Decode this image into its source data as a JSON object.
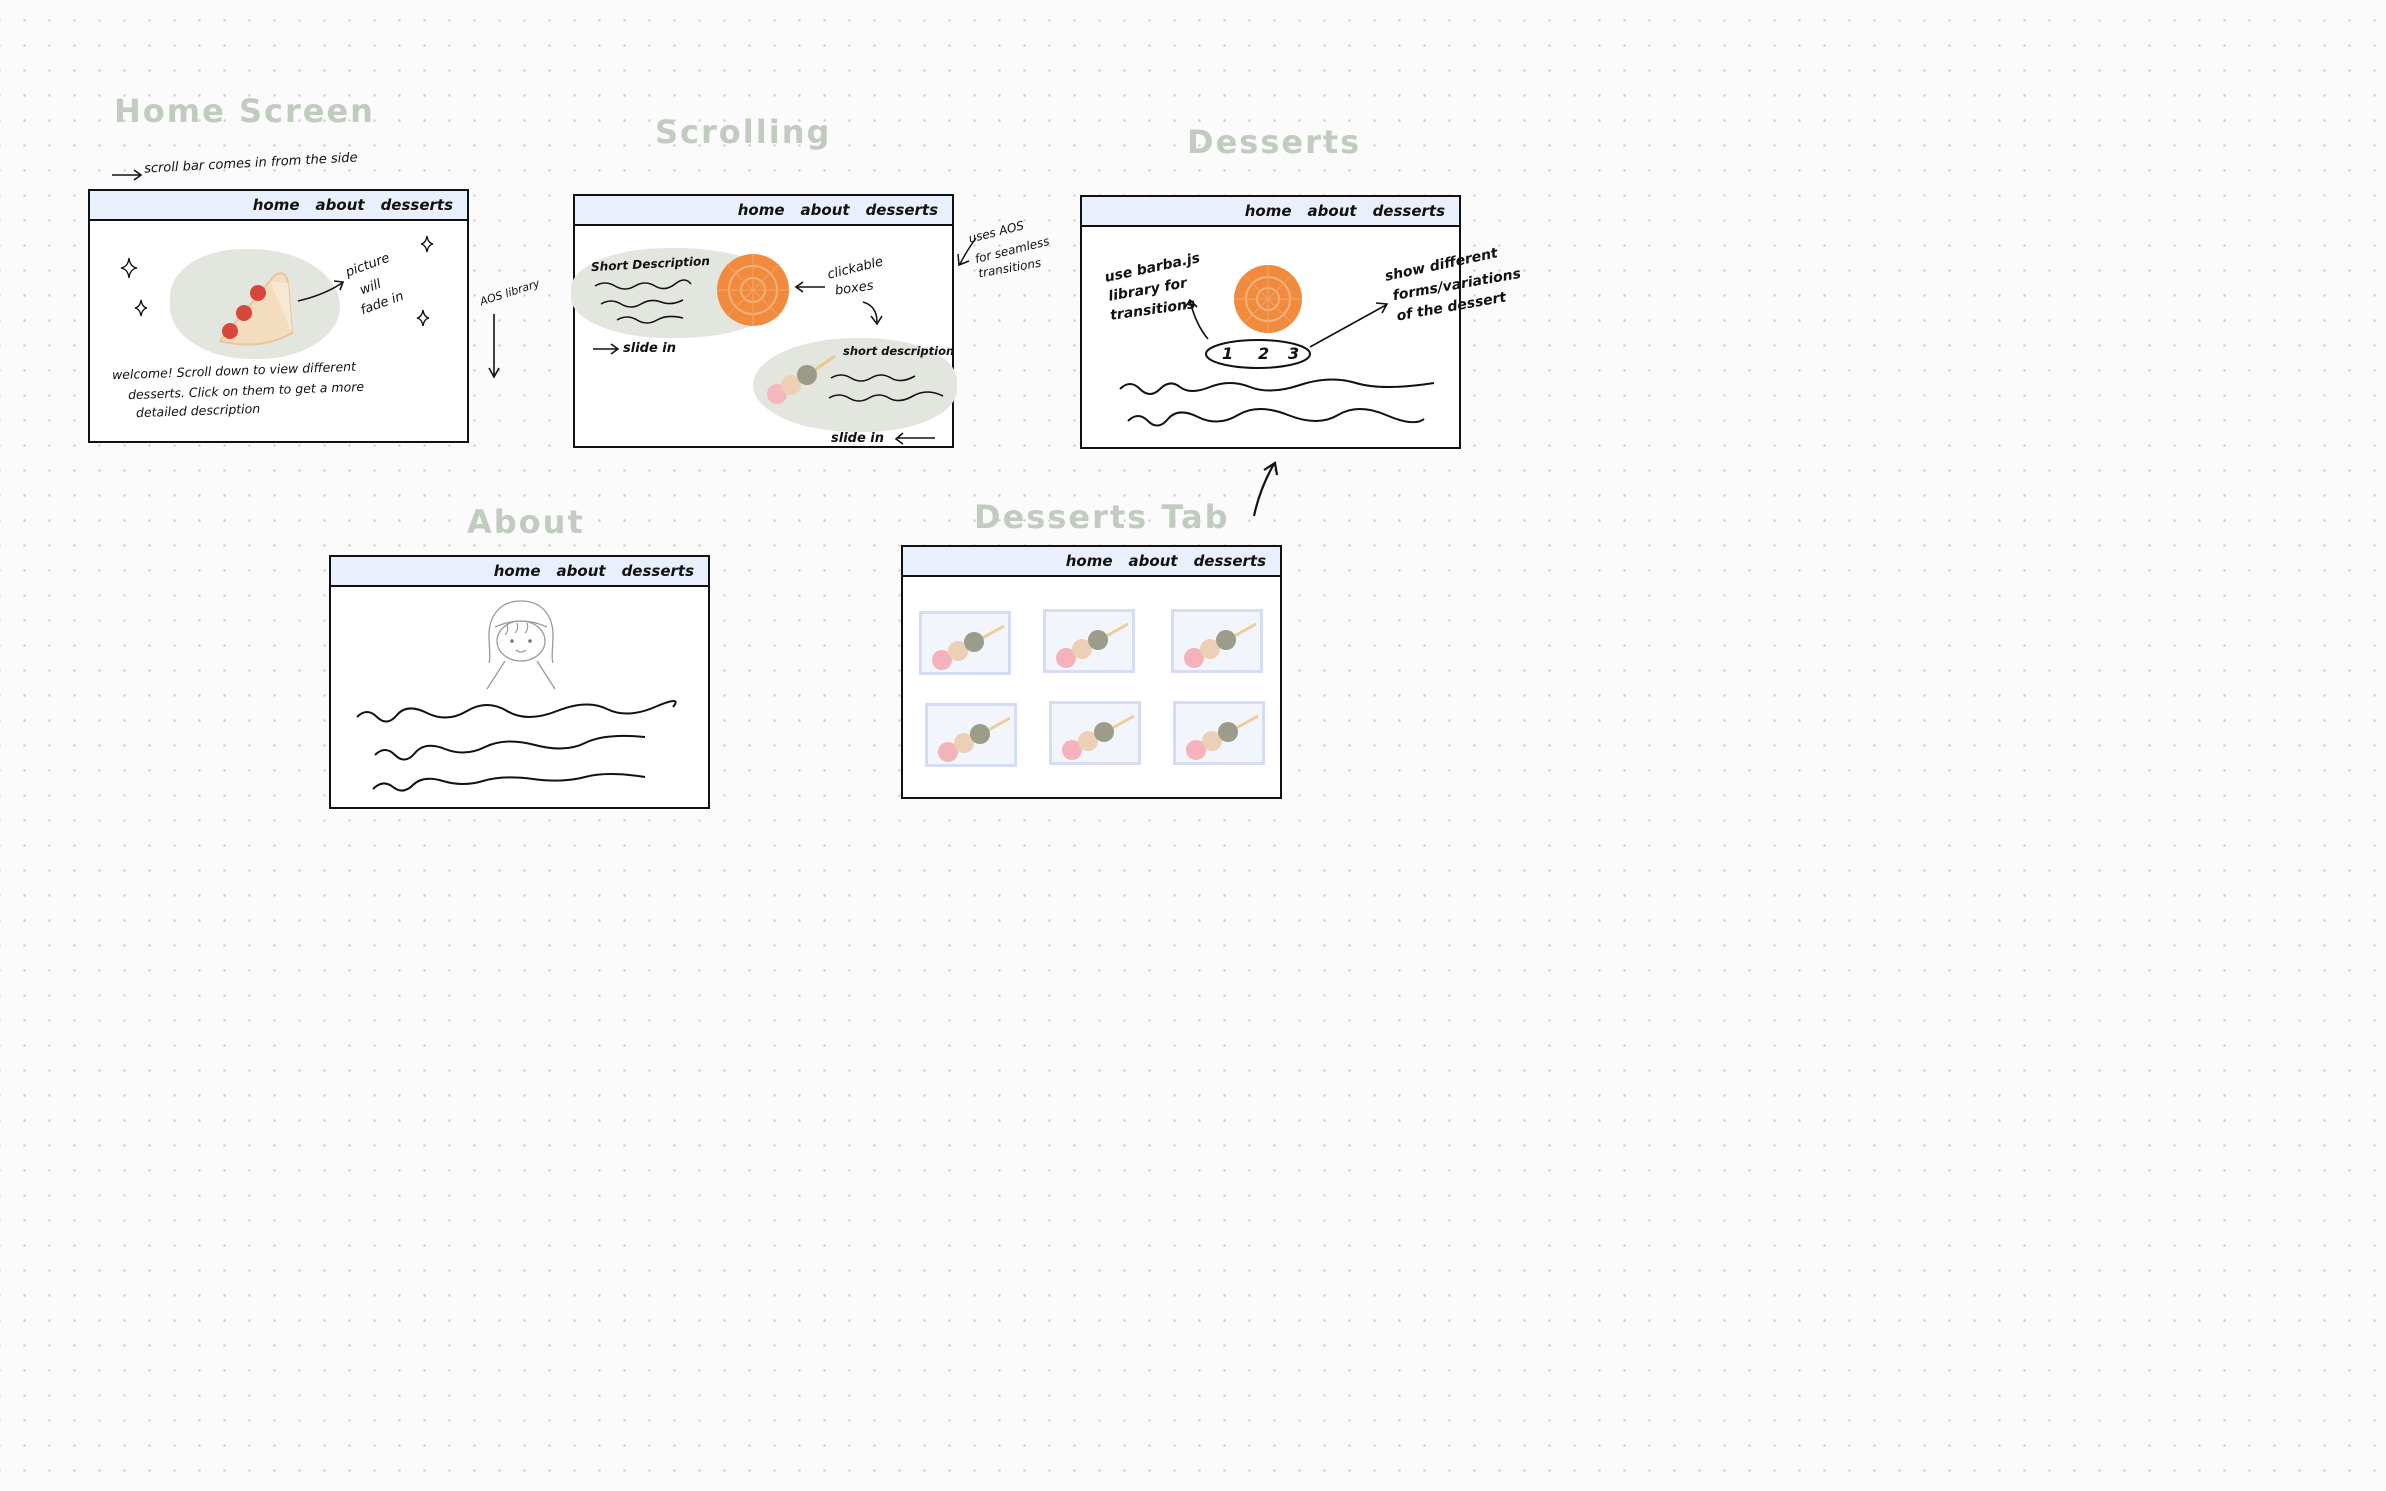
{
  "sections": {
    "home": "Home Screen",
    "scrolling": "Scrolling",
    "desserts": "Desserts",
    "about": "About",
    "desserts_tab": "Desserts Tab"
  },
  "nav": {
    "home": "home",
    "about": "about",
    "desserts": "desserts"
  },
  "notes": {
    "scroll_bar": "scroll bar comes in from the side",
    "picture_fade": [
      "picture",
      "will",
      "fade in"
    ],
    "welcome": [
      "welcome!  Scroll down to view different",
      "desserts. Click on them to get a more",
      "detailed  description"
    ],
    "aos_library": "AOS library",
    "short_description_1": "Short Description",
    "clickable_boxes": [
      "clickable",
      "boxes"
    ],
    "slide_in_1": "slide in",
    "short_description_2": "short description",
    "slide_in_2": "slide in",
    "uses_aos": [
      "uses AOS",
      "for seamless",
      "transitions"
    ],
    "barba": [
      "use barba.js",
      "library for",
      "transitions"
    ],
    "variations": [
      "show different",
      "forms/variations",
      "of the dessert"
    ],
    "pager": [
      "1",
      "2",
      "3"
    ]
  },
  "colors": {
    "title": "#c1cbc0",
    "navbar": "#eaf0fb",
    "blob": "#e3e6df",
    "mooncake": "#f08a3c",
    "thumb_border": "#d5ddf5"
  }
}
